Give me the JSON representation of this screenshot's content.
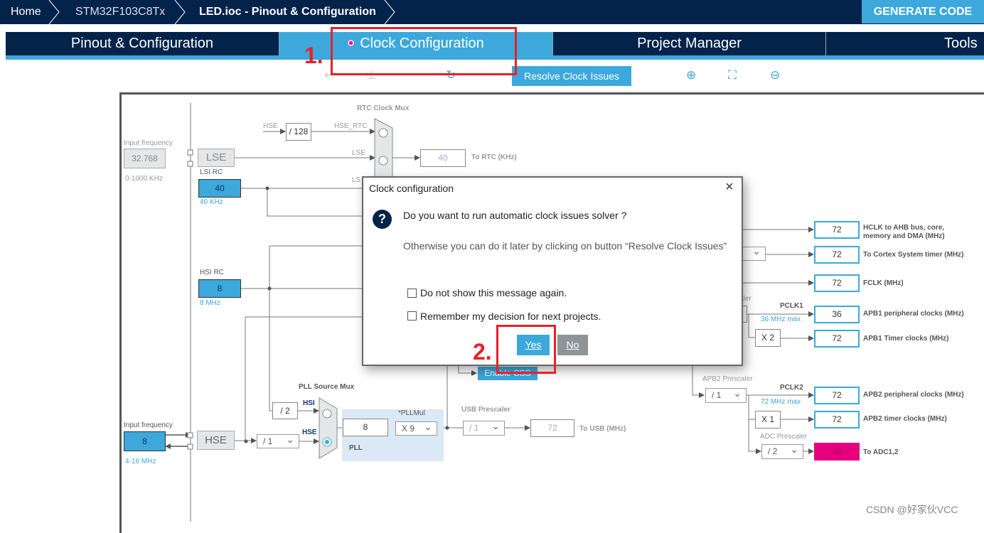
{
  "breadcrumb": {
    "items": [
      "Home",
      "STM32F103C8Tx",
      "LED.ioc - Pinout & Configuration"
    ]
  },
  "generate_code": "GENERATE CODE",
  "tabs": [
    "Pinout & Configuration",
    "Clock Configuration",
    "Project Manager",
    "Tools"
  ],
  "toolbar": {
    "resolve": "Resolve Clock Issues",
    "icons": [
      "undo-icon",
      "redo-icon",
      "refresh-icon",
      "zoom-in-icon",
      "fit-icon",
      "zoom-out-icon"
    ]
  },
  "diagram": {
    "lse_input": {
      "label": "Input frequency",
      "value": "32.768",
      "range": "0-1000 KHz"
    },
    "lse": "LSE",
    "lsi": {
      "label": "LSI RC",
      "value": "40",
      "unit": "40 KHz"
    },
    "hsi": {
      "label": "HSI RC",
      "value": "8",
      "unit": "8 MHz"
    },
    "rtc_mux": {
      "label": "RTC Clock Mux",
      "hse": "HSE",
      "div": "/ 128",
      "hse_rtc": "HSE_RTC",
      "lse": "LSE",
      "lsi": "LS",
      "value": "40",
      "out": "To RTC (KHz)"
    },
    "hse_input": {
      "label": "Input frequency",
      "value": "8",
      "range": "4-16 MHz"
    },
    "hse": "HSE",
    "hse_div": "/ 1",
    "hsi_div": "/ 2",
    "pll_mux": {
      "label": "PLL Source Mux",
      "hsi": "HSI",
      "hse": "HSE"
    },
    "pll": {
      "label": "PLL",
      "mul_label": "*PLLMul",
      "value": "8",
      "mul": "X 9"
    },
    "usb": {
      "label": "USB Prescaler",
      "div": "/ 1",
      "value": "72",
      "out": "To USB (MHz)"
    },
    "enable_css": "Enable CSS",
    "outputs": [
      {
        "value": "72",
        "label": "HCLK to AHB bus, core, memory and DMA (MHz)"
      },
      {
        "value": "72",
        "label": "To Cortex System timer (MHz)"
      },
      {
        "value": "72",
        "label": "FCLK (MHz)"
      },
      {
        "value": "36",
        "label": "APB1 peripheral clocks (MHz)"
      },
      {
        "value": "72",
        "label": "APB1 Timer clocks (MHz)"
      },
      {
        "value": "72",
        "label": "APB2 peripheral clocks (MHz)"
      },
      {
        "value": "72",
        "label": "APB2 timer clocks (MHz)"
      },
      {
        "value": "36",
        "label": "To ADC1,2"
      }
    ],
    "apb1": {
      "partial_label": "aler",
      "pclk": "PCLK1",
      "max": "36 MHz max",
      "timer_mul": "X 2"
    },
    "apb2": {
      "label": "APB2 Prescaler",
      "div": "/ 1",
      "pclk": "PCLK2",
      "max": "72 MHz max",
      "timer_mul": "X 1"
    },
    "adc": {
      "label": "ADC Prescaler",
      "div": "/ 2",
      "color": "#e6007e"
    }
  },
  "dialog": {
    "title": "Clock configuration",
    "question": "Do you want to run automatic clock issues solver ?",
    "info": "Otherwise you can do it later by clicking on button “Resolve Clock Issues”",
    "checkbox1": "Do not show this message again.",
    "checkbox2": "Remember my decision for next projects.",
    "yes": "Yes",
    "no": "No"
  },
  "annotations": {
    "step1": "1.",
    "step2": "2."
  },
  "watermark": "CSDN @好家伙VCC",
  "colors": {
    "navy": "#03234b",
    "accent": "#3ca8dc",
    "annotation": "#e8202a"
  }
}
